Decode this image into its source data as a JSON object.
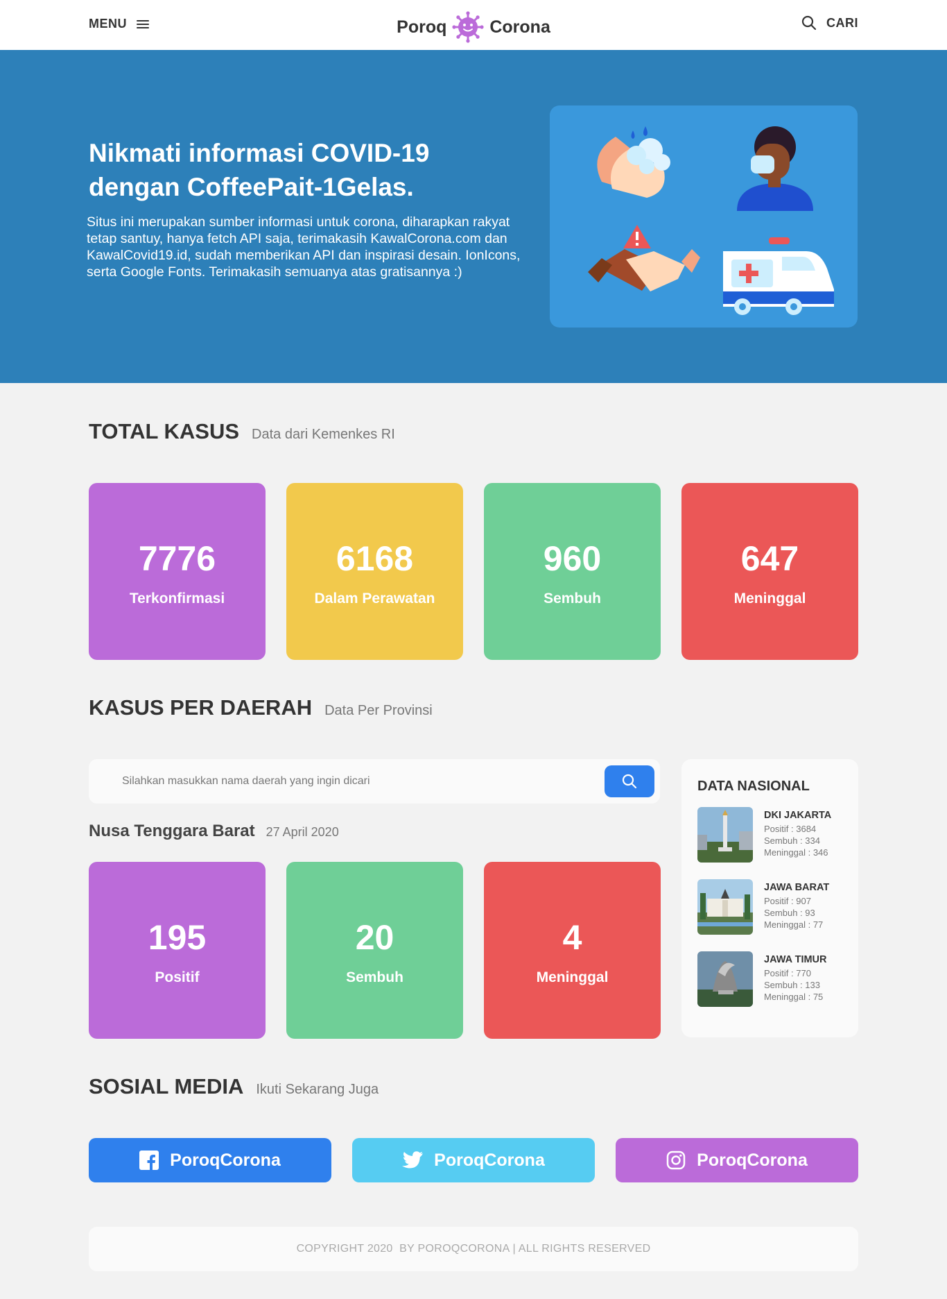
{
  "header": {
    "menu_label": "MENU",
    "brand_left": "Poroq",
    "brand_right": "Corona",
    "search_label": "CARI"
  },
  "hero": {
    "title": "Nikmati informasi COVID-19 dengan CoffeePait-1Gelas.",
    "description": "Situs ini merupakan sumber informasi untuk corona, diharapkan rakyat tetap santuy, hanya fetch API saja, terimakasih KawalCorona.com dan KawalCovid19.id, sudah memberikan API dan inspirasi desain. IonIcons, serta Google Fonts. Terimakasih semuanya atas gratisannya :)"
  },
  "total": {
    "title": "TOTAL KASUS",
    "subtitle": "Data dari Kemenkes RI",
    "cards": [
      {
        "value": "7776",
        "label": "Terkonfirmasi",
        "color": "#bb6bd9"
      },
      {
        "value": "6168",
        "label": "Dalam Perawatan",
        "color": "#f2c94c"
      },
      {
        "value": "960",
        "label": "Sembuh",
        "color": "#6fcf97"
      },
      {
        "value": "647",
        "label": "Meninggal",
        "color": "#eb5757"
      }
    ]
  },
  "daerah": {
    "title": "KASUS PER DAERAH",
    "subtitle": "Data Per Provinsi",
    "search_placeholder": "Silahkan masukkan nama daerah yang ingin dicari",
    "region_name": "Nusa Tenggara Barat",
    "region_date": "27 April 2020",
    "cards": [
      {
        "value": "195",
        "label": "Positif"
      },
      {
        "value": "20",
        "label": "Sembuh"
      },
      {
        "value": "4",
        "label": "Meninggal"
      }
    ]
  },
  "nasional": {
    "title": "DATA NASIONAL",
    "provinces": [
      {
        "name": "DKI JAKARTA",
        "positif": "Positif : 3684",
        "sembuh": "Sembuh : 334",
        "meninggal": "Meninggal : 346"
      },
      {
        "name": "JAWA BARAT",
        "positif": "Positif : 907",
        "sembuh": "Sembuh : 93",
        "meninggal": "Meninggal : 77"
      },
      {
        "name": "JAWA TIMUR",
        "positif": "Positif : 770",
        "sembuh": "Sembuh : 133",
        "meninggal": "Meninggal : 75"
      }
    ]
  },
  "social": {
    "title": "SOSIAL MEDIA",
    "subtitle": "Ikuti Sekarang Juga",
    "facebook": "PoroqCorona",
    "twitter": "PoroqCorona",
    "instagram": "PoroqCorona"
  },
  "footer": {
    "text": "COPYRIGHT 2020  BY POROQCORONA | ALL RIGHTS RESERVED"
  },
  "colors": {
    "hero_bg": "#2d80b9",
    "purple": "#bb6bd9",
    "yellow": "#f2c94c",
    "green": "#6fcf97",
    "red": "#eb5757",
    "blue": "#2f80ed",
    "light_blue": "#56ccf2"
  },
  "icons": [
    "hamburger-icon",
    "virus-logo-icon",
    "search-icon",
    "facebook-icon",
    "twitter-icon",
    "instagram-icon"
  ]
}
